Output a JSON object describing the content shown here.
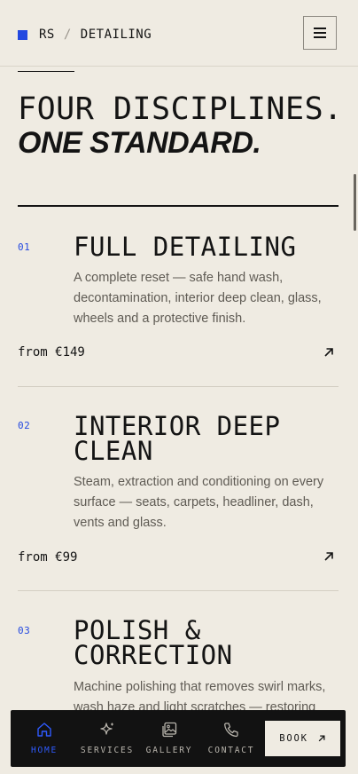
{
  "header": {
    "brand_code": "RS",
    "separator": "/",
    "section": "DETAILING",
    "accent": "#2348e0",
    "menu_icon": "hamburger-icon"
  },
  "hero": {
    "line1": "FOUR DISCIPLINES.",
    "line2": "ONE STANDARD."
  },
  "services": [
    {
      "number": "01",
      "title": "FULL DETAILING",
      "description": "A complete reset — safe hand wash, decontamination, interior deep clean, glass, wheels and a protective finish.",
      "price": "from €149"
    },
    {
      "number": "02",
      "title": "INTERIOR DEEP CLEAN",
      "description": "Steam, extraction and conditioning on every surface — seats, carpets, headliner, dash, vents and glass.",
      "price": "from €99"
    },
    {
      "number": "03",
      "title": "POLISH & CORRECTION",
      "description": "Machine polishing that removes swirl marks, wash haze and light scratches — restoring"
    }
  ],
  "bottom_nav": {
    "items": [
      {
        "label": "HOME",
        "icon": "home-icon",
        "active": true
      },
      {
        "label": "SERVICES",
        "icon": "sparkle-icon",
        "active": false
      },
      {
        "label": "GALLERY",
        "icon": "gallery-icon",
        "active": false
      },
      {
        "label": "CONTACT",
        "icon": "phone-icon",
        "active": false
      }
    ],
    "book_label": "BOOK",
    "active_color": "#2f5bff"
  }
}
